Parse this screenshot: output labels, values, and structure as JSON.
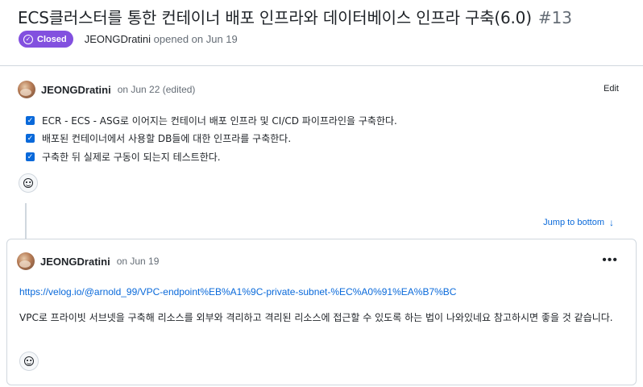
{
  "issue": {
    "title": "ECS클러스터를 통한 컨테이너 배포 인프라와 데이터베이스 인프라 구축(6.0)",
    "number": "#13",
    "status": "Closed",
    "status_icon": "check-circle-icon",
    "author": "JEONGDratini",
    "opened_text": "opened on Jun 19"
  },
  "first_comment": {
    "author": "JEONGDratini",
    "date": "on Jun 22 (edited)",
    "edit_label": "Edit",
    "tasks": [
      {
        "text": "ECR - ECS - ASG로 이어지는 컨테이너 배포 인프라 및 CI/CD 파이프라인을 구축한다.",
        "checked": true
      },
      {
        "text": "배포된 컨테이너에서 사용할 DB들에 대한 인프라를 구축한다.",
        "checked": true
      },
      {
        "text": "구축한 뒤 실제로 구동이 되는지 테스트한다.",
        "checked": true
      }
    ]
  },
  "timeline": {
    "jump_label": "Jump to bottom",
    "jump_icon": "arrow-down-icon"
  },
  "second_comment": {
    "author": "JEONGDratini",
    "date": "on Jun 19",
    "more_icon": "kebab-horizontal-icon",
    "link": "https://velog.io/@arnold_99/VPC-endpoint%EB%A1%9C-private-subnet-%EC%A0%91%EA%B7%BC",
    "body": "VPC로 프라이빗 서브넷을 구축해 리소스를 외부와 격리하고 격리된 리소스에 접근할 수 있도록 하는 법이 나와있네요 참고하시면 좋을 것 같습니다."
  },
  "colors": {
    "closed_badge": "#8250df",
    "link": "#0969da",
    "checkbox": "#0969da",
    "border": "#d0d7de",
    "muted_text": "#656d76"
  }
}
